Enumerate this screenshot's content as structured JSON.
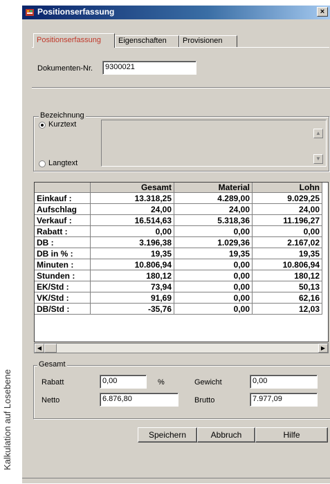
{
  "side_caption": "Kalkulation auf Losebene",
  "window": {
    "title": "Positionserfassung",
    "close_glyph": "×",
    "accent": "#0a246a"
  },
  "tabs": [
    {
      "label": "Positionserfassung",
      "active": true
    },
    {
      "label": "Eigenschaften",
      "active": false
    },
    {
      "label": "Provisionen",
      "active": false
    }
  ],
  "doc": {
    "label": "Dokumenten-Nr.",
    "value": "9300021"
  },
  "bezeichnung": {
    "title": "Bezeichnung",
    "options": [
      {
        "label": "Kurztext",
        "selected": true
      },
      {
        "label": "Langtext",
        "selected": false
      }
    ],
    "text": ""
  },
  "grid": {
    "columns": [
      "",
      "Gesamt",
      "Material",
      "Lohn"
    ],
    "rows": [
      [
        "Einkauf :",
        "13.318,25",
        "4.289,00",
        "9.029,25"
      ],
      [
        "Aufschlag",
        "24,00",
        "24,00",
        "24,00"
      ],
      [
        "Verkauf :",
        "16.514,63",
        "5.318,36",
        "11.196,27"
      ],
      [
        "Rabatt :",
        "0,00",
        "0,00",
        "0,00"
      ],
      [
        "DB :",
        "3.196,38",
        "1.029,36",
        "2.167,02"
      ],
      [
        "DB in % :",
        "19,35",
        "19,35",
        "19,35"
      ],
      [
        "Minuten :",
        "10.806,94",
        "0,00",
        "10.806,94"
      ],
      [
        "Stunden :",
        "180,12",
        "0,00",
        "180,12"
      ],
      [
        "EK/Std :",
        "73,94",
        "0,00",
        "50,13"
      ],
      [
        "VK/Std :",
        "91,69",
        "0,00",
        "62,16"
      ],
      [
        "DB/Std :",
        "-35,76",
        "0,00",
        "12,03"
      ]
    ]
  },
  "gesamt": {
    "title": "Gesamt",
    "rabatt_label": "Rabatt",
    "rabatt_value": "0,00",
    "percent": "%",
    "gewicht_label": "Gewicht",
    "gewicht_value": "0,00",
    "netto_label": "Netto",
    "netto_value": "6.876,80",
    "brutto_label": "Brutto",
    "brutto_value": "7.977,09"
  },
  "buttons": {
    "save": "Speichern",
    "cancel": "Abbruch",
    "help": "Hilfe"
  }
}
